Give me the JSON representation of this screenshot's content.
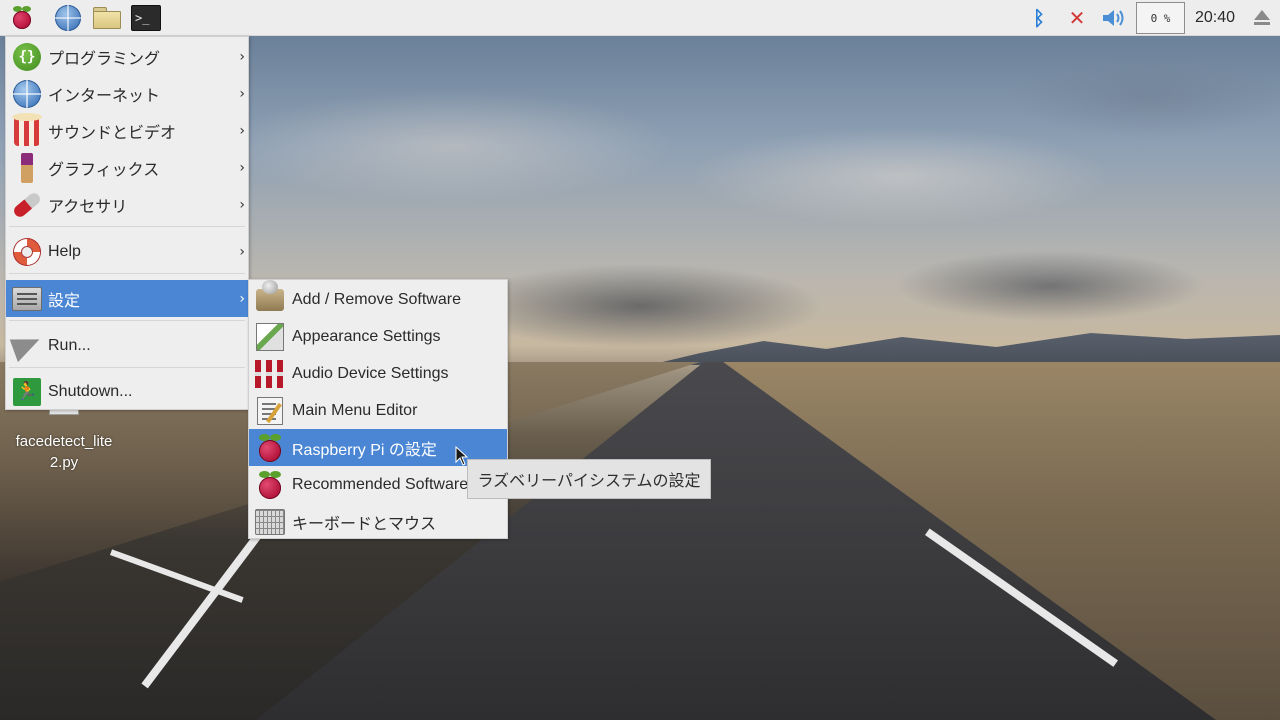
{
  "panel": {
    "cpu_usage": "0 %",
    "clock": "20:40",
    "launchers": [
      {
        "icon": "raspberry-pi-menu-icon"
      },
      {
        "icon": "web-browser-icon"
      },
      {
        "icon": "file-manager-icon"
      },
      {
        "icon": "terminal-icon",
        "glyph": ">_"
      }
    ],
    "tray": [
      {
        "icon": "bluetooth-icon",
        "glyph": "ᛒ",
        "color": "#2a7fd6"
      },
      {
        "icon": "network-disconnected-icon",
        "glyph": "✕",
        "color": "#d23a3a"
      },
      {
        "icon": "volume-icon",
        "glyph": "🔊",
        "color": "#4a8fd6"
      }
    ]
  },
  "desktop": {
    "file_icon_label": "facedetect_lite\n2.py"
  },
  "main_menu": {
    "items": [
      {
        "label": "プログラミング",
        "icon": "programming-icon",
        "has_submenu": true
      },
      {
        "label": "インターネット",
        "icon": "internet-icon",
        "has_submenu": true
      },
      {
        "label": "サウンドとビデオ",
        "icon": "sound-video-icon",
        "has_submenu": true
      },
      {
        "label": "グラフィックス",
        "icon": "graphics-icon",
        "has_submenu": true
      },
      {
        "label": "アクセサリ",
        "icon": "accessories-icon",
        "has_submenu": true
      },
      {
        "label": "Help",
        "icon": "help-icon",
        "has_submenu": true
      },
      {
        "label": "設定",
        "icon": "settings-icon",
        "has_submenu": true,
        "selected": true
      },
      {
        "label": "Run...",
        "icon": "run-icon",
        "has_submenu": false
      },
      {
        "label": "Shutdown...",
        "icon": "shutdown-icon",
        "has_submenu": false
      }
    ]
  },
  "settings_submenu": {
    "items": [
      {
        "label": "Add / Remove Software",
        "icon": "add-remove-software-icon"
      },
      {
        "label": "Appearance Settings",
        "icon": "appearance-settings-icon"
      },
      {
        "label": "Audio Device Settings",
        "icon": "audio-device-settings-icon"
      },
      {
        "label": "Main Menu Editor",
        "icon": "main-menu-editor-icon"
      },
      {
        "label": "Raspberry Pi の設定",
        "icon": "raspberry-pi-config-icon",
        "selected": true
      },
      {
        "label": "Recommended Software",
        "icon": "recommended-software-icon"
      },
      {
        "label": "キーボードとマウス",
        "icon": "keyboard-mouse-icon"
      }
    ]
  },
  "tooltip": {
    "text": "ラズベリーパイシステムの設定"
  },
  "colors": {
    "selection": "#4a86d4",
    "menu_bg": "#eeeeee",
    "panel_bg": "#ededed"
  }
}
